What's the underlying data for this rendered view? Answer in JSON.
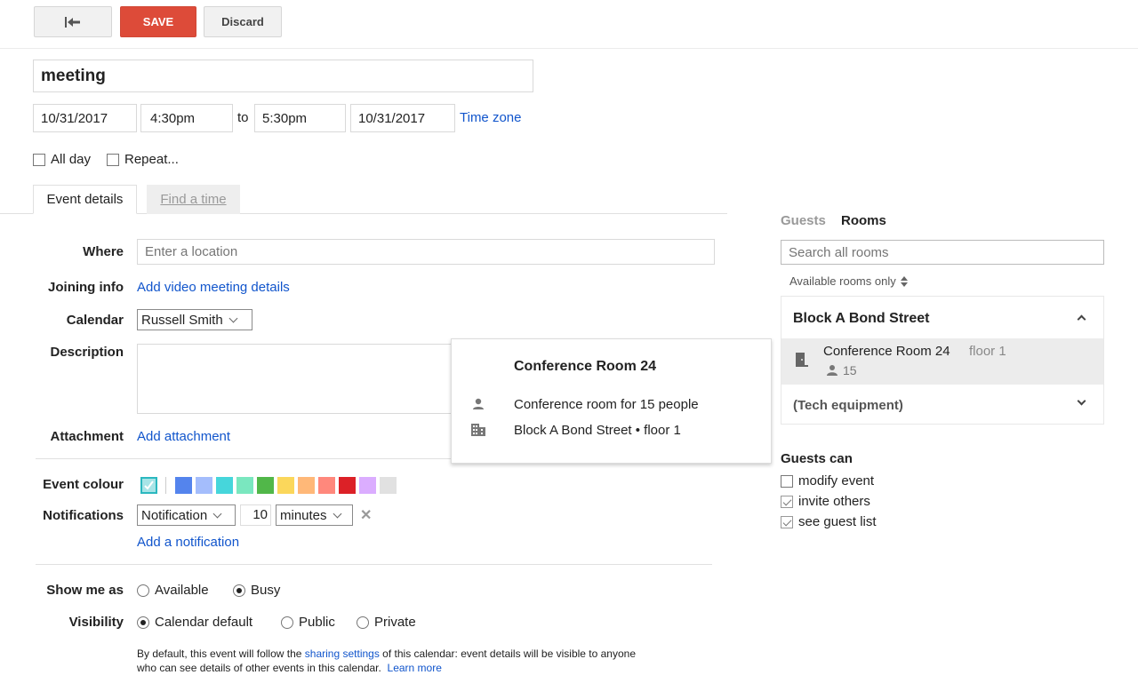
{
  "toolbar": {
    "back_icon": "back-arrow-icon",
    "save_label": "SAVE",
    "discard_label": "Discard"
  },
  "event": {
    "title": "meeting",
    "start_date": "10/31/2017",
    "start_time": "4:30pm",
    "to_label": "to",
    "end_time": "5:30pm",
    "end_date": "10/31/2017",
    "time_zone_link": "Time zone",
    "all_day_label": "All day",
    "all_day_checked": false,
    "repeat_label": "Repeat...",
    "repeat_checked": false
  },
  "tabs": [
    {
      "label": "Event details",
      "active": true
    },
    {
      "label": "Find a time",
      "active": false
    }
  ],
  "details": {
    "where_label": "Where",
    "where_placeholder": "Enter a location",
    "joining_label": "Joining info",
    "joining_link": "Add video meeting details",
    "calendar_label": "Calendar",
    "calendar_value": "Russell Smith",
    "description_label": "Description",
    "description_value": "",
    "attachment_label": "Attachment",
    "attachment_link": "Add attachment",
    "colour_label": "Event colour",
    "colours": [
      "#4ad2d9",
      "#5484ed",
      "#a4bdfc",
      "#46d6db",
      "#7ae7bf",
      "#51b749",
      "#fbd75b",
      "#ffb878",
      "#ff887c",
      "#dc2127",
      "#dbadff",
      "#e1e1e1"
    ],
    "selected_colour": "#4ad2d9",
    "notifications_label": "Notifications",
    "notification_type": "Notification",
    "notification_value": "10",
    "notification_unit": "minutes",
    "add_notification_link": "Add a notification",
    "show_me_as_label": "Show me as",
    "show_me_as_options": [
      {
        "label": "Available",
        "selected": false
      },
      {
        "label": "Busy",
        "selected": true
      }
    ],
    "visibility_label": "Visibility",
    "visibility_options": [
      {
        "label": "Calendar default",
        "selected": true
      },
      {
        "label": "Public",
        "selected": false
      },
      {
        "label": "Private",
        "selected": false
      }
    ],
    "visibility_note_pre": "By default, this event will follow the",
    "visibility_note_link": "sharing settings",
    "visibility_note_mid": "of this calendar: event details will be visible to anyone",
    "visibility_note_line2": "who can see details of other events in this calendar.",
    "learn_more_link": "Learn more"
  },
  "popup": {
    "title": "Conference Room 24",
    "capacity_text": "Conference room for 15 people",
    "location_text": "Block A Bond Street • floor 1"
  },
  "sidebar": {
    "tabs": [
      {
        "label": "Guests",
        "active": false
      },
      {
        "label": "Rooms",
        "active": true
      }
    ],
    "search_placeholder": "Search all rooms",
    "filter_label": "Available rooms only",
    "groups": [
      {
        "name": "Block A Bond Street",
        "expanded": true,
        "rooms": [
          {
            "name": "Conference Room 24",
            "floor": "floor 1",
            "capacity": "15"
          }
        ]
      },
      {
        "name": "(Tech equipment)",
        "expanded": false,
        "rooms": []
      }
    ],
    "guests_can_label": "Guests can",
    "permissions": [
      {
        "label": "modify event",
        "checked": false
      },
      {
        "label": "invite others",
        "checked": true
      },
      {
        "label": "see guest list",
        "checked": true
      }
    ]
  }
}
